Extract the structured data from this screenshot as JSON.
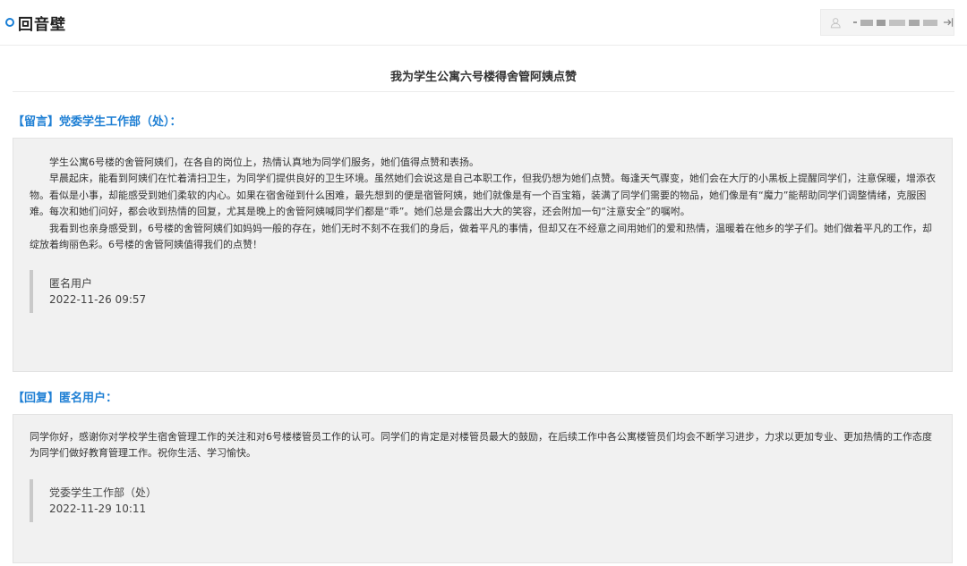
{
  "header": {
    "app_title": "回音壁",
    "user_icon": "user-icon",
    "logout_icon": "logout-icon"
  },
  "page_title": "我为学生公寓六号楼得舍管阿姨点赞",
  "message": {
    "label": "【留言】党委学生工作部（处）：",
    "paragraphs": [
      "学生公寓6号楼的舍管阿姨们，在各自的岗位上，热情认真地为同学们服务，她们值得点赞和表扬。",
      "早晨起床，能看到阿姨们在忙着清扫卫生，为同学们提供良好的卫生环境。虽然她们会说这是自己本职工作，但我仍想为她们点赞。每逢天气骤变，她们会在大厅的小黑板上提醒同学们，注意保暖，增添衣物。看似是小事，却能感受到她们柔软的内心。如果在宿舍碰到什么困难，最先想到的便是宿管阿姨，她们就像是有一个百宝箱，装满了同学们需要的物品，她们像是有“魔力”能帮助同学们调整情绪，克服困难。每次和她们问好，都会收到热情的回复，尤其是晚上的舍管阿姨喊同学们都是“乖”。她们总是会露出大大的笑容，还会附加一句“注意安全”的嘱咐。",
      "我看到也亲身感受到，6号楼的舍管阿姨们如妈妈一般的存在，她们无时不刻不在我们的身后，做着平凡的事情，但却又在不经意之间用她们的爱和热情，温暖着在他乡的学子们。她们做着平凡的工作，却绽放着绚丽色彩。6号楼的舍管阿姨值得我们的点赞！"
    ],
    "author": "匿名用户",
    "time": "2022-11-26 09:57"
  },
  "reply": {
    "label": "【回复】匿名用户：",
    "paragraphs": [
      "同学你好，感谢你对学校学生宿舍管理工作的关注和对6号楼楼管员工作的认可。同学们的肯定是对楼管员最大的鼓励，在后续工作中各公寓楼管员们均会不断学习进步，力求以更加专业、更加热情的工作态度为同学们做好教育管理工作。祝你生活、学习愉快。"
    ],
    "author": "党委学生工作部（处）",
    "time": "2022-11-29 10:11"
  },
  "colors": {
    "accent": "#1e7fd4",
    "card_bg": "#f1f1f1",
    "signature_bar": "#c9c9c9"
  }
}
